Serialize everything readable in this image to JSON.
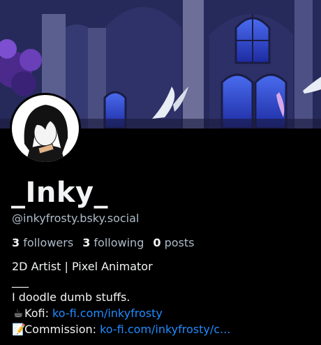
{
  "profile": {
    "display_name": "_Inky_",
    "handle": "@inkyfrosty.bsky.social",
    "stats": {
      "followers_count": "3",
      "followers_label": "followers",
      "following_count": "3",
      "following_label": "following",
      "posts_count": "0",
      "posts_label": "posts"
    },
    "bio": {
      "line1": "2D Artist | Pixel Animator",
      "line2": "___",
      "line3": "I doodle dumb stuffs.",
      "kofi_emoji": "☕",
      "kofi_label": "Kofi: ",
      "kofi_link": "ko-fi.com/inkyfrosty",
      "commission_emoji": "📝",
      "commission_label": "Commission: ",
      "commission_link": "ko-fi.com/inkyfrosty/c..."
    }
  },
  "colors": {
    "background": "#000000",
    "text": "#f1f3f5",
    "muted": "#aebbc9",
    "link": "#208bfe"
  }
}
